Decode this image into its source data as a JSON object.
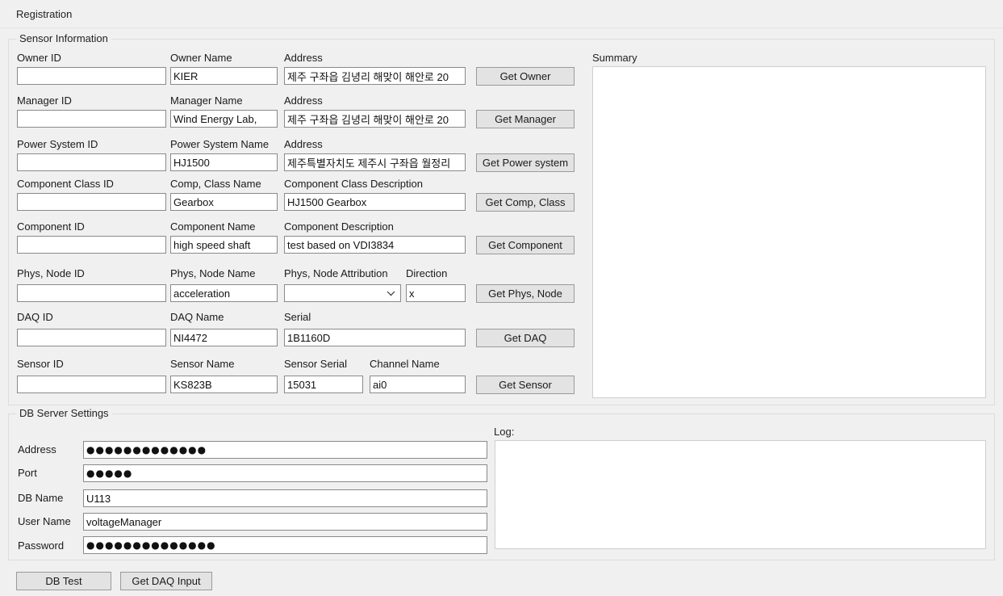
{
  "window": {
    "title": "Registration"
  },
  "sensor_information": {
    "legend": "Sensor Information",
    "rows": [
      {
        "id_label": "Owner ID",
        "id_value": "",
        "name_label": "Owner Name",
        "name_value": "KIER",
        "desc_label": "Address",
        "desc_value": "제주 구좌읍 김녕리 해맞이 해안로 20",
        "button": "Get Owner"
      },
      {
        "id_label": "Manager ID",
        "id_value": "",
        "name_label": "Manager Name",
        "name_value": "Wind Energy Lab,",
        "desc_label": "Address",
        "desc_value": "제주 구좌읍 김녕리 해맞이 해안로 20",
        "button": "Get Manager"
      },
      {
        "id_label": "Power System ID",
        "id_value": "",
        "name_label": "Power System Name",
        "name_value": "HJ1500",
        "desc_label": "Address",
        "desc_value": "제주특별자치도 제주시 구좌읍 월정리",
        "button": "Get Power system"
      },
      {
        "id_label": "Component Class ID",
        "id_value": "",
        "name_label": "Comp, Class Name",
        "name_value": "Gearbox",
        "desc_label": "Component Class Description",
        "desc_value": "HJ1500 Gearbox",
        "button": "Get Comp, Class"
      },
      {
        "id_label": "Component ID",
        "id_value": "",
        "name_label": "Component Name",
        "name_value": "high speed shaft",
        "desc_label": "Component Description",
        "desc_value": "test based on VDI3834",
        "button": "Get Component"
      }
    ],
    "phys_node": {
      "id_label": "Phys, Node ID",
      "id_value": "",
      "name_label": "Phys, Node Name",
      "name_value": "acceleration",
      "attribution_label": "Phys, Node Attribution",
      "attribution_value": "",
      "direction_label": "Direction",
      "direction_value": "x",
      "button": "Get Phys, Node"
    },
    "daq": {
      "id_label": "DAQ ID",
      "id_value": "",
      "name_label": "DAQ Name",
      "name_value": "NI4472",
      "serial_label": "Serial",
      "serial_value": "1B1160D",
      "button": "Get DAQ"
    },
    "sensor": {
      "id_label": "Sensor ID",
      "id_value": "",
      "name_label": "Sensor Name",
      "name_value": "KS823B",
      "serial_label": "Sensor Serial",
      "serial_value": "15031",
      "channel_label": "Channel Name",
      "channel_value": "ai0",
      "button": "Get Sensor"
    },
    "summary": {
      "label": "Summary",
      "content": ""
    }
  },
  "db_server_settings": {
    "legend": "DB Server Settings",
    "fields": [
      {
        "label": "Address",
        "value": "●●●●●●●●●●●●●"
      },
      {
        "label": "Port",
        "value": "●●●●●"
      },
      {
        "label": "DB Name",
        "value": "U113"
      },
      {
        "label": "User Name",
        "value": "voltageManager"
      },
      {
        "label": "Password",
        "value": "●●●●●●●●●●●●●●"
      }
    ],
    "log": {
      "label": "Log:",
      "content": ""
    },
    "buttons": {
      "db_test": "DB Test",
      "get_daq_input": "Get DAQ Input"
    }
  }
}
